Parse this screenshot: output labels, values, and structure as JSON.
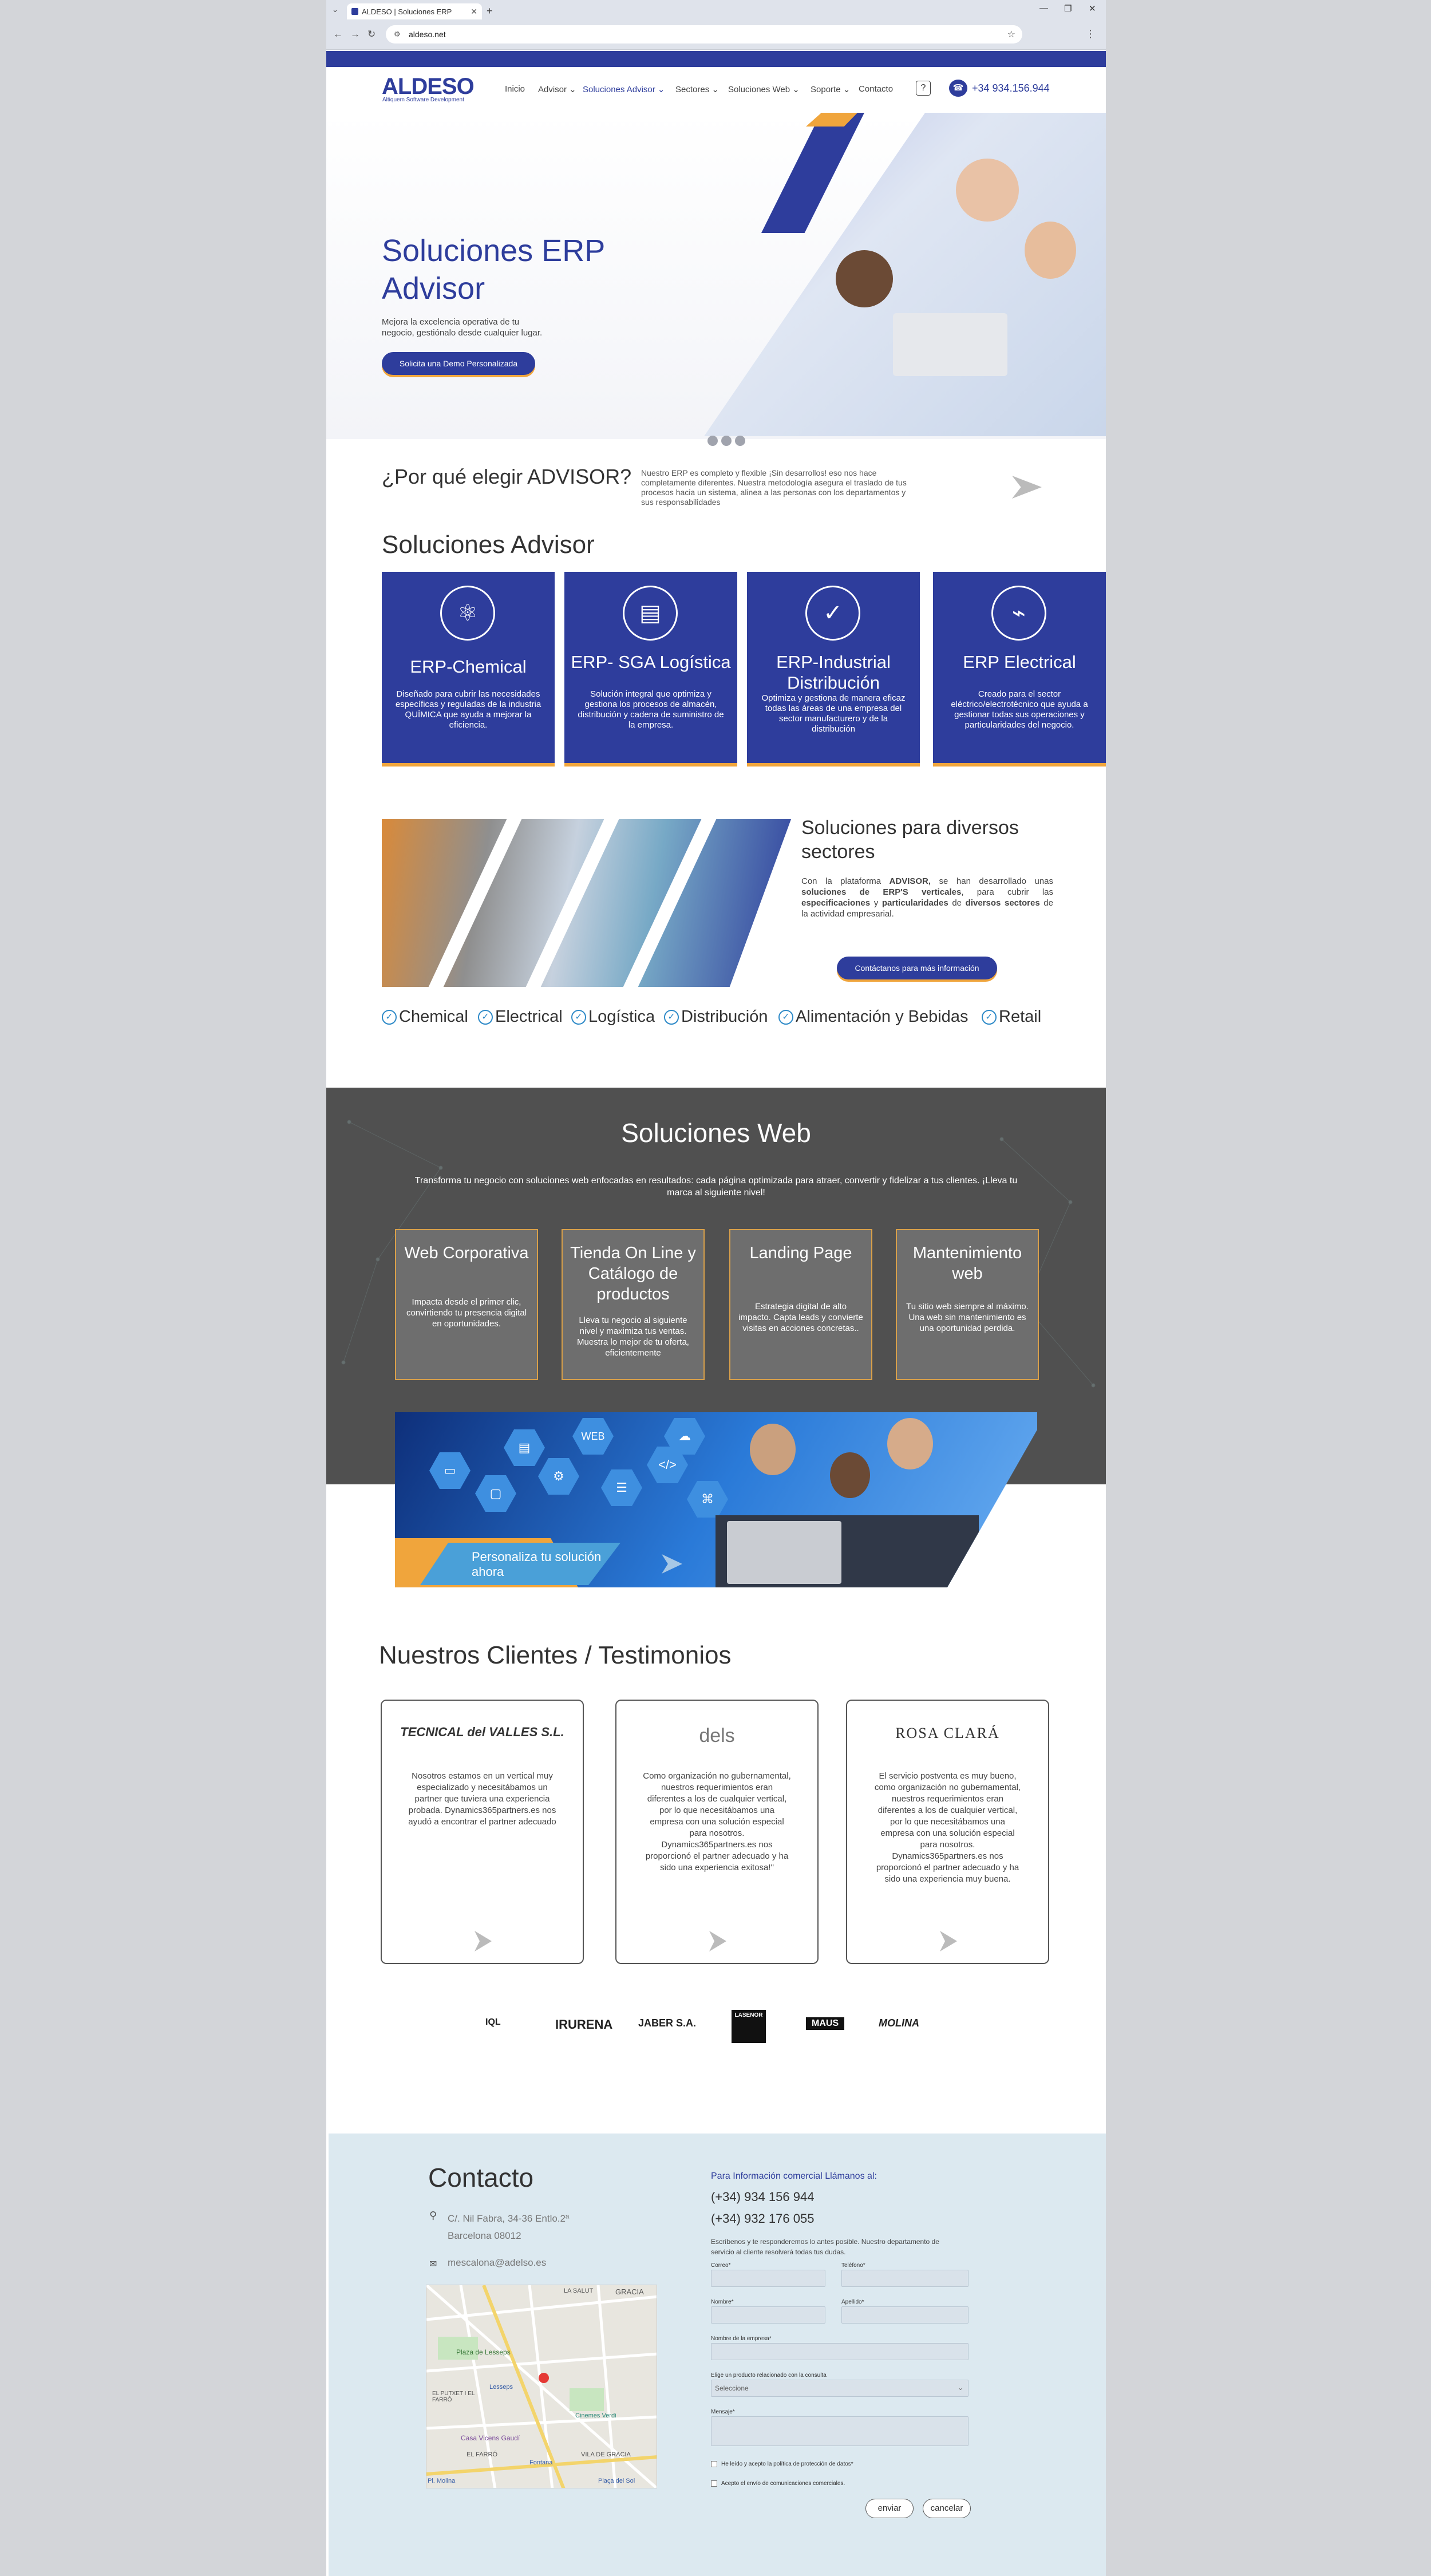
{
  "browser": {
    "tab_title": "ALDESO | Soluciones ERP",
    "url": "aldeso.net"
  },
  "header": {
    "logo": "ALDESO",
    "logo_sub": "Altiquem Software Development",
    "nav": [
      "Inicio",
      "Advisor ⌄",
      "Soluciones Advisor ⌄",
      "Sectores ⌄",
      "Soluciones Web ⌄",
      "Soporte ⌄",
      "Contacto"
    ],
    "help": "?",
    "phone": "+34 934.156.944"
  },
  "hero": {
    "title": "Soluciones ERP Advisor",
    "desc": "Mejora la excelencia operativa de tu negocio, gestiónalo desde cualquier lugar.",
    "cta": "Solicita una Demo Personalizada"
  },
  "why": {
    "title": "¿Por qué elegir ADVISOR?",
    "text": "Nuestro ERP es completo y flexible ¡Sin desarrollos! eso nos hace completamente diferentes. Nuestra metodología asegura el traslado de tus procesos hacia un sistema, alinea a las personas con los departamentos y sus responsabilidades"
  },
  "advisor": {
    "title": "Soluciones Advisor",
    "cards": [
      {
        "title": "ERP-Chemical",
        "text": "Diseñado para cubrir las necesidades específicas y reguladas de la industria QUÍMICA que ayuda a mejorar la eficiencia.",
        "icon": "atom-icon",
        "glyph": "⚛"
      },
      {
        "title": "ERP- SGA Logística",
        "text": "Solución integral que optimiza y gestiona los procesos de almacén, distribución y cadena de suministro de la empresa.",
        "icon": "boxes-icon",
        "glyph": "▤"
      },
      {
        "title": "ERP-Industrial Distribución",
        "text": "Optimiza y gestiona de manera eficaz todas las áreas de una empresa del sector manufacturero y de la distribución",
        "icon": "check-network-icon",
        "glyph": "✓"
      },
      {
        "title": "ERP Electrical",
        "text": "Creado para el sector eléctrico/electrotécnico que ayuda a gestionar todas sus operaciones y particularidades del negocio.",
        "icon": "circuit-icon",
        "glyph": "⌁"
      }
    ]
  },
  "sectors": {
    "title": "Soluciones para diversos sectores",
    "text_parts": [
      "Con la plataforma ",
      "ADVISOR,",
      " se han desarrollado unas ",
      "soluciones de ERP'S verticales",
      ", para cubrir las ",
      "especificaciones",
      " y ",
      "particularidades",
      " de ",
      "diversos sectores",
      " de la actividad empresarial."
    ],
    "cta": "Contáctanos para más información",
    "tags": [
      "Chemical",
      "Electrical",
      "Logística",
      "Distribución",
      "Alimentación y Bebidas",
      "Retail"
    ]
  },
  "web": {
    "title": "Soluciones Web",
    "desc": "Transforma tu negocio con soluciones web enfocadas en resultados: cada página optimizada para atraer, convertir y fidelizar a tus clientes. ¡Lleva tu marca al siguiente nivel!",
    "cards": [
      {
        "title": "Web Corporativa",
        "text": "Impacta desde el primer clic, convirtiendo tu presencia digital en oportunidades."
      },
      {
        "title": "Tienda On Line y Catálogo de productos",
        "text": "Lleva tu negocio al siguiente nivel y maximiza tus ventas. Muestra lo mejor de tu oferta, eficientemente"
      },
      {
        "title": "Landing Page",
        "text": "Estrategia digital de alto impacto. Capta leads y convierte visitas en acciones concretas.."
      },
      {
        "title": "Mantenimiento web",
        "text": "Tu sitio web siempre al máximo. Una web sin mantenimiento es una oportunidad perdida."
      }
    ],
    "banner_cta": "Personaliza tu solución ahora",
    "banner_web": "WEB"
  },
  "testimonials": {
    "title": "Nuestros Clientes / Testimonios",
    "cards": [
      {
        "logo": "TECNICAL del VALLES S.L.",
        "text": "Nosotros estamos en un vertical muy especializado y necesitábamos un partner que tuviera una experiencia probada. Dynamics365partners.es nos ayudó a encontrar el partner adecuado"
      },
      {
        "logo": "dels",
        "text": "Como organización no gubernamental, nuestros requerimientos eran diferentes a los de cualquier vertical, por lo que necesitábamos una empresa con una solución especial para nosotros. Dynamics365partners.es nos proporcionó el partner adecuado y ha sido una experiencia exitosa!\""
      },
      {
        "logo": "ROSA CLARÁ",
        "text": "El servicio postventa es muy bueno, como organización no gubernamental, nuestros requerimientos eran diferentes a los de cualquier vertical, por lo que necesitábamos una empresa con una solución especial para nosotros. Dynamics365partners.es nos proporcionó el partner adecuado y ha sido una experiencia muy buena."
      }
    ],
    "brand_logos": [
      "IQL",
      "IRURENA",
      "JABER S.A.",
      "LASENOR",
      "MAUS",
      "MOLINA"
    ]
  },
  "contact": {
    "title": "Contacto",
    "address_line1": "C/. Nil Fabra, 34-36 Entlo.2ª",
    "address_line2": "Barcelona 08012",
    "email": "mescalona@adelso.es",
    "info_heading": "Para Información comercial Llámanos al:",
    "phone1": "(+34) 934 156 944",
    "phone2": "(+34) 932 176 055",
    "info_text": "Escríbenos y te responderemos lo antes posible. Nuestro departamento de servicio al cliente resolverá todas tus dudas.",
    "labels": {
      "correo": "Correo*",
      "telefono": "Teléfono*",
      "nombre": "Nombre*",
      "apellido": "Apellido*",
      "empresa": "Nombre de la empresa*",
      "producto": "Elige un producto relacionado con la consulta",
      "mensaje": "Mensaje*"
    },
    "select_placeholder": "Seleccione",
    "privacy": "He leído y acepto la política de protección de datos*",
    "newsletter": "Acepto el envío de comunicaciones comerciales.",
    "submit": "enviar",
    "cancel": "cancelar"
  },
  "map_labels": [
    "LA SALUT",
    "GRACIA",
    "Plaza de Lesseps",
    "Lesseps",
    "EL PUTXET I EL FARRÓ",
    "Casa Vicens Gaudí",
    "EL FARRÓ",
    "Cinemes Verdi",
    "VILA DE GRACIA",
    "Fontana",
    "Pl. Molina",
    "Plaça del Sol"
  ],
  "colors": {
    "brand": "#2e3d9c",
    "accent": "#f0a53c",
    "dark_section": "#505050",
    "contact_bg": "#dce9f0"
  }
}
